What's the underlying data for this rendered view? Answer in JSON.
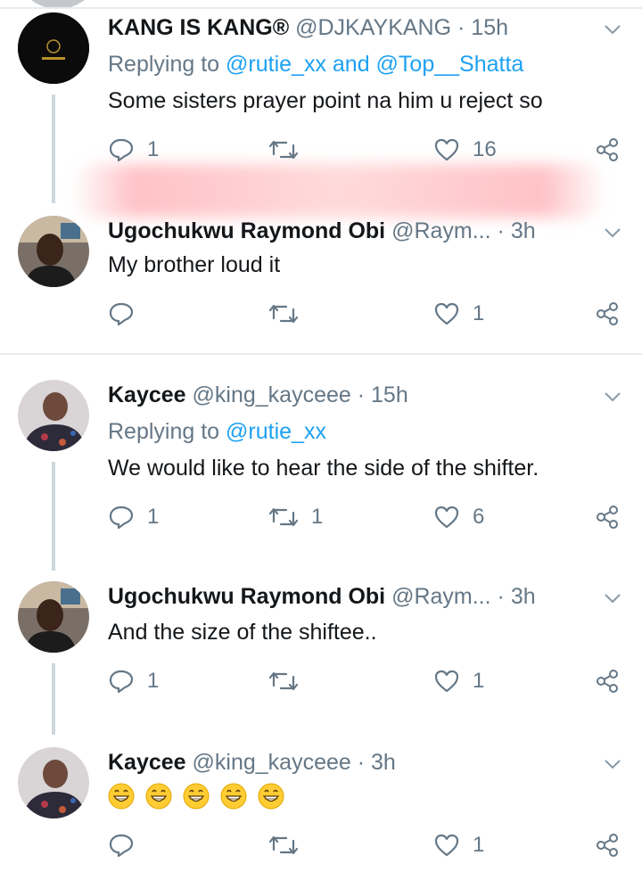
{
  "tweets": [
    {
      "name": "KANG IS KANG®",
      "handle": "@DJKAYKANG",
      "dot": "·",
      "time": "15h",
      "replying_prefix": "Replying to",
      "replying_mentions": "@rutie_xx and @Top__Shatta",
      "text": "Some sisters prayer point na him u reject so",
      "reply_count": "1",
      "retweet_count": "",
      "like_count": "16"
    },
    {
      "name": "Ugochukwu Raymond Obi",
      "handle": "@Raym...",
      "dot": "·",
      "time": "3h",
      "text": "My brother loud it",
      "reply_count": "",
      "retweet_count": "",
      "like_count": "1"
    },
    {
      "name": "Kaycee",
      "handle": "@king_kayceee",
      "dot": "·",
      "time": "15h",
      "replying_prefix": "Replying to",
      "replying_mentions": "@rutie_xx",
      "text": "We would like to hear the side of the shifter.",
      "reply_count": "1",
      "retweet_count": "1",
      "like_count": "6"
    },
    {
      "name": "Ugochukwu Raymond Obi",
      "handle": "@Raym...",
      "dot": "·",
      "time": "3h",
      "text": "And the size of the shiftee..",
      "reply_count": "1",
      "retweet_count": "",
      "like_count": "1"
    },
    {
      "name": "Kaycee",
      "handle": "@king_kayceee",
      "dot": "·",
      "time": "3h",
      "emoji": [
        "😁",
        "😁",
        "😁",
        "😁",
        "😁"
      ],
      "reply_count": "",
      "retweet_count": "",
      "like_count": "1"
    }
  ],
  "colors": {
    "link": "#1da1f2",
    "muted": "#657786",
    "text": "#14171a",
    "thread_line": "#ccd6dd"
  },
  "icons": [
    "reply-icon",
    "retweet-icon",
    "like-icon",
    "share-icon",
    "chevron-down-icon"
  ]
}
